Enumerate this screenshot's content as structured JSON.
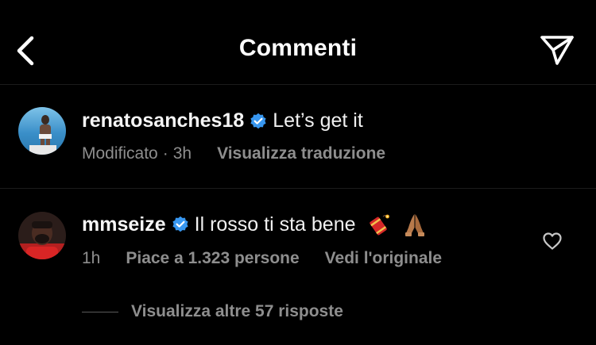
{
  "header": {
    "title": "Commenti",
    "back_icon": "chevron-left-icon",
    "send_icon": "paper-plane-icon"
  },
  "caption": {
    "username": "renatosanches18",
    "verified": true,
    "text": "Let’s get it",
    "edited": "Modificato",
    "separator": "·",
    "time": "3h",
    "translate": "Visualizza traduzione"
  },
  "reply": {
    "username": "mmseize",
    "verified": true,
    "text": "Il rosso ti sta bene",
    "emojis": [
      "firecracker",
      "folded-hands"
    ],
    "time": "1h",
    "likes": "Piace a 1.323 persone",
    "original": "Vedi l'originale",
    "heart_icon": "heart-outline-icon",
    "view_replies": "Visualizza altre 57 risposte"
  },
  "colors": {
    "background": "#000000",
    "text": "#f5f5f5",
    "secondary": "#8e8e8e",
    "verified": "#3897f0"
  }
}
